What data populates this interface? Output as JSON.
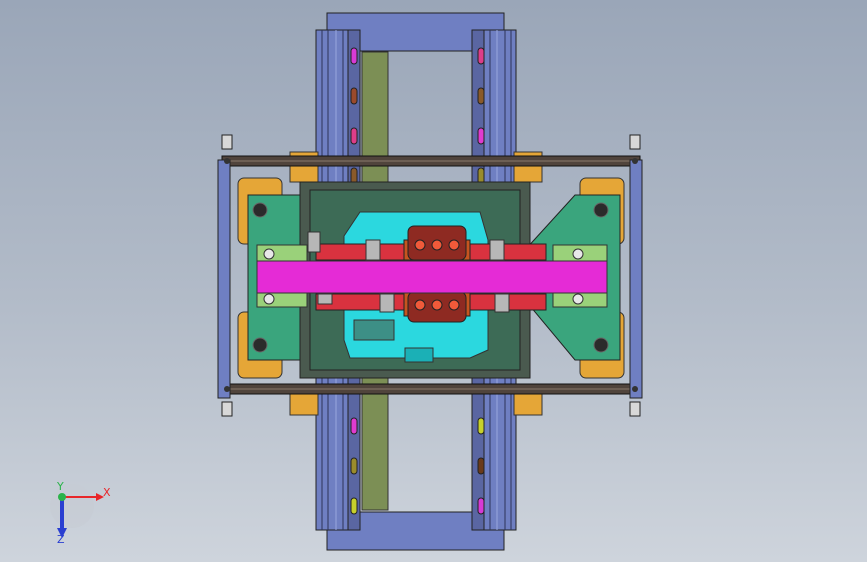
{
  "triad": {
    "x_label": "X",
    "y_label": "Y",
    "z_label": "Z",
    "colors": {
      "x": "#e8262a",
      "y": "#2bb34a",
      "z": "#2a3fd1"
    }
  },
  "palette": {
    "rail": "#6f7fc2",
    "rail_dark": "#3c4679",
    "olive": "#7c8f55",
    "frame": "#50443c",
    "orange": "#e5a637",
    "green": "#3aa57d",
    "light_green": "#9ad17a",
    "magenta": "#e52bd6",
    "red": "#d9323f",
    "cyan": "#2bd8df",
    "dark_red": "#8e2a22",
    "grey": "#b7b7b7",
    "slot_colors": [
      "#d73ad6",
      "#9a4a2c",
      "#dd3d89",
      "#8a5a2a",
      "#e03bd0",
      "#9a8c2c",
      "#c8d12c",
      "#6a3a1a"
    ]
  }
}
